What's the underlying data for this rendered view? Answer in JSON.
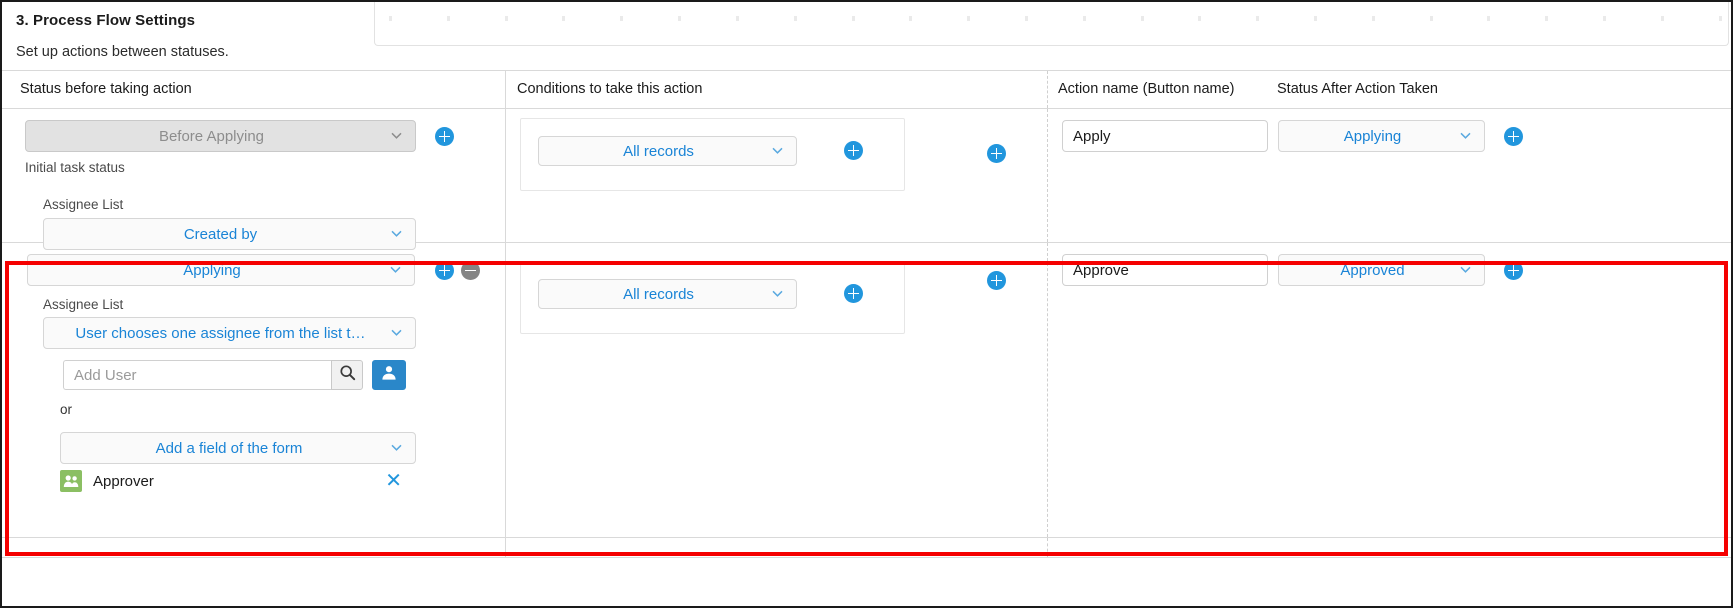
{
  "section": {
    "title": "3. Process Flow Settings",
    "subtitle": "Set up actions between statuses."
  },
  "table": {
    "headers": {
      "status_before": "Status before taking action",
      "conditions": "Conditions to take this action",
      "action_name": "Action name (Button name)",
      "status_after": "Status After Action Taken"
    },
    "rows": [
      {
        "status_before": {
          "value": "Before Applying",
          "disabled": true,
          "note": "Initial task status",
          "assignee_label": "Assignee List",
          "assignee_value": "Created by"
        },
        "condition": "All records",
        "action_name": "Apply",
        "status_after": "Applying"
      },
      {
        "status_before": {
          "value": "Applying",
          "disabled": false,
          "assignee_label": "Assignee List",
          "assignee_value": "User chooses one assignee from the list t…",
          "add_user_placeholder": "Add User",
          "or_label": "or",
          "form_field_value": "Add a field of the form",
          "chip": "Approver"
        },
        "condition": "All records",
        "action_name": "Approve",
        "status_after": "Approved"
      }
    ]
  },
  "icons": {
    "chevron": "chevron-down-icon",
    "plus": "plus-icon",
    "minus": "minus-icon",
    "search": "search-icon",
    "person": "person-icon",
    "group": "group-icon",
    "close": "close-icon"
  },
  "colors": {
    "accent_blue": "#2196dd",
    "link_blue": "#1a84d6",
    "highlight_red": "#f50000",
    "chip_green": "#8bbf63",
    "minus_gray": "#858585"
  }
}
